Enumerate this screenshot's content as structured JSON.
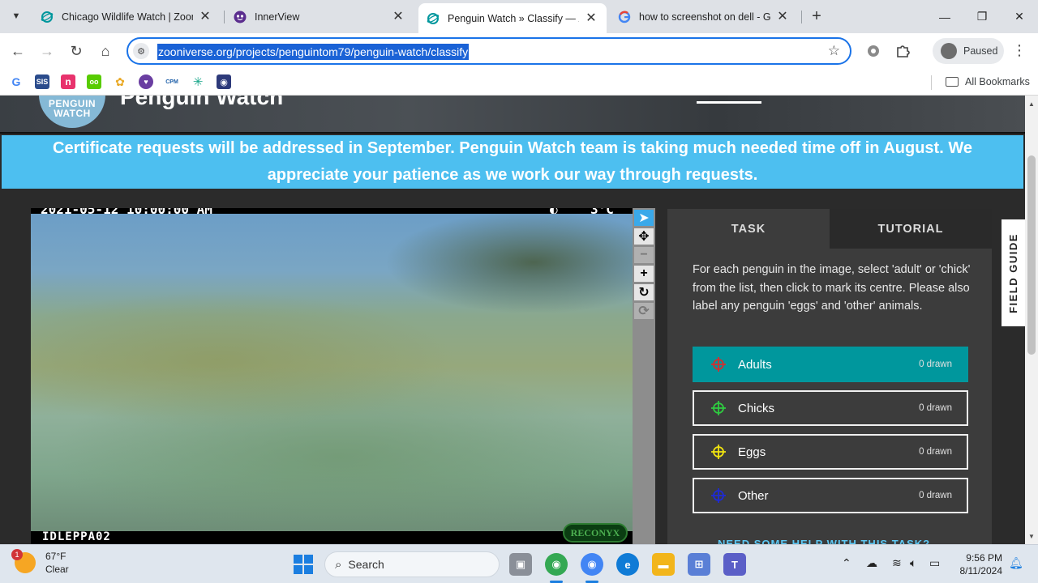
{
  "browser": {
    "tabs": [
      {
        "title": "Chicago Wildlife Watch | Zooniverse",
        "active": false
      },
      {
        "title": "InnerView",
        "active": false
      },
      {
        "title": "Penguin Watch » Classify — Zooniverse",
        "active": true
      },
      {
        "title": "how to screenshot on dell - Google",
        "active": false
      }
    ],
    "url": "zooniverse.org/projects/penguintom79/penguin-watch/classify",
    "profile_label": "Paused",
    "all_bookmarks": "All Bookmarks",
    "bookmarks": [
      {
        "icon": "google-icon",
        "label": "G",
        "color": "#4285f4"
      },
      {
        "icon": "sis-icon",
        "label": "SIS",
        "color": "#2b4c8c"
      },
      {
        "icon": "n-icon",
        "label": "n",
        "color": "#e8336d"
      },
      {
        "icon": "duolingo-icon",
        "label": "oo",
        "color": "#58cc02"
      },
      {
        "icon": "flower-icon",
        "label": "✿",
        "color": "#e9c46a"
      },
      {
        "icon": "innerview-icon",
        "label": "♥",
        "color": "#6a3ea1"
      },
      {
        "icon": "cpm-icon",
        "label": "CPM",
        "color": "#1d5fa8"
      },
      {
        "icon": "asterisk-icon",
        "label": "✳",
        "color": "#17a589"
      },
      {
        "icon": "shield-bookmark-icon",
        "label": "◉",
        "color": "#2d3a7a"
      }
    ]
  },
  "site": {
    "logo_text_line1": "PENGUIN",
    "logo_text_line2": "WATCH",
    "title": "Penguin Watch",
    "banner": "Certificate requests will be addressed in September. Penguin Watch team is taking much needed time off in August. We appreciate your patience as we work our way through requests."
  },
  "camera": {
    "timestamp": "2021-05-12 10:00:00 AM",
    "temperature": "3°C",
    "camera_id": "IDLEPPA02",
    "brand": "RECONYX"
  },
  "panel": {
    "tab_task": "TASK",
    "tab_tutorial": "TUTORIAL",
    "instructions": "For each penguin in the image, select 'adult' or 'chick' from the list, then click to mark its centre. Please also label any penguin 'eggs' and 'other' animals.",
    "tools": [
      {
        "name": "Adults",
        "count": "0 drawn",
        "color": "#d32f2f",
        "active": true
      },
      {
        "name": "Chicks",
        "count": "0 drawn",
        "color": "#2ecc40",
        "active": false
      },
      {
        "name": "Eggs",
        "count": "0 drawn",
        "color": "#f1e40f",
        "active": false
      },
      {
        "name": "Other",
        "count": "0 drawn",
        "color": "#1e2ad6",
        "active": false
      }
    ],
    "help_link": "NEED SOME HELP WITH THIS TASK?"
  },
  "field_guide": "FIELD GUIDE",
  "taskbar": {
    "weather_temp": "67°F",
    "weather_desc": "Clear",
    "weather_badge": "1",
    "search_label": "Search",
    "time": "9:56 PM",
    "date": "8/11/2024"
  },
  "colors": {
    "banner": "#4dbff0",
    "active_tool": "#00979d",
    "accent": "#1a73e8"
  }
}
